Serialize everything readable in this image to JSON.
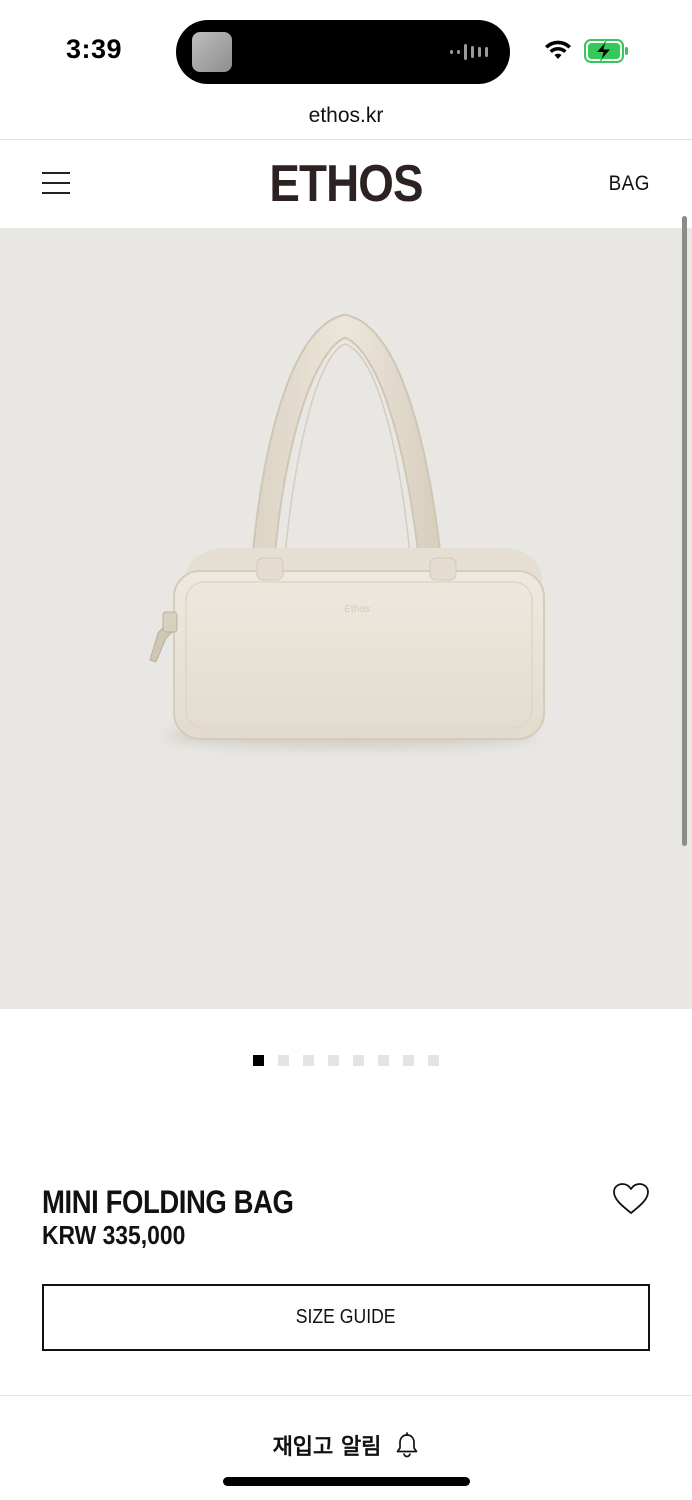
{
  "status_bar": {
    "time": "3:39",
    "icons": [
      "now-playing-thumbnail",
      "audio-waveform-icon",
      "wifi-icon",
      "battery-charging-icon"
    ]
  },
  "browser": {
    "url": "ethos.kr"
  },
  "header": {
    "logo": "ETHOS",
    "category_link": "BAG",
    "menu_icon": "hamburger-menu-icon"
  },
  "gallery": {
    "image_description": "",
    "total_images": 8,
    "active_index": 0
  },
  "product": {
    "name": "MINI FOLDING BAG",
    "price": "KRW 335,000",
    "wishlist_icon": "heart-outline-icon",
    "size_guide_label": "SIZE GUIDE"
  },
  "bottom_bar": {
    "restock_label": "재입고 알림",
    "restock_icon": "bell-icon"
  },
  "colors": {
    "image_background": "#e9e7e4",
    "logo": "#2b2221",
    "bag": "#e6e0d4",
    "text": "#111111",
    "battery": "#34c759"
  }
}
